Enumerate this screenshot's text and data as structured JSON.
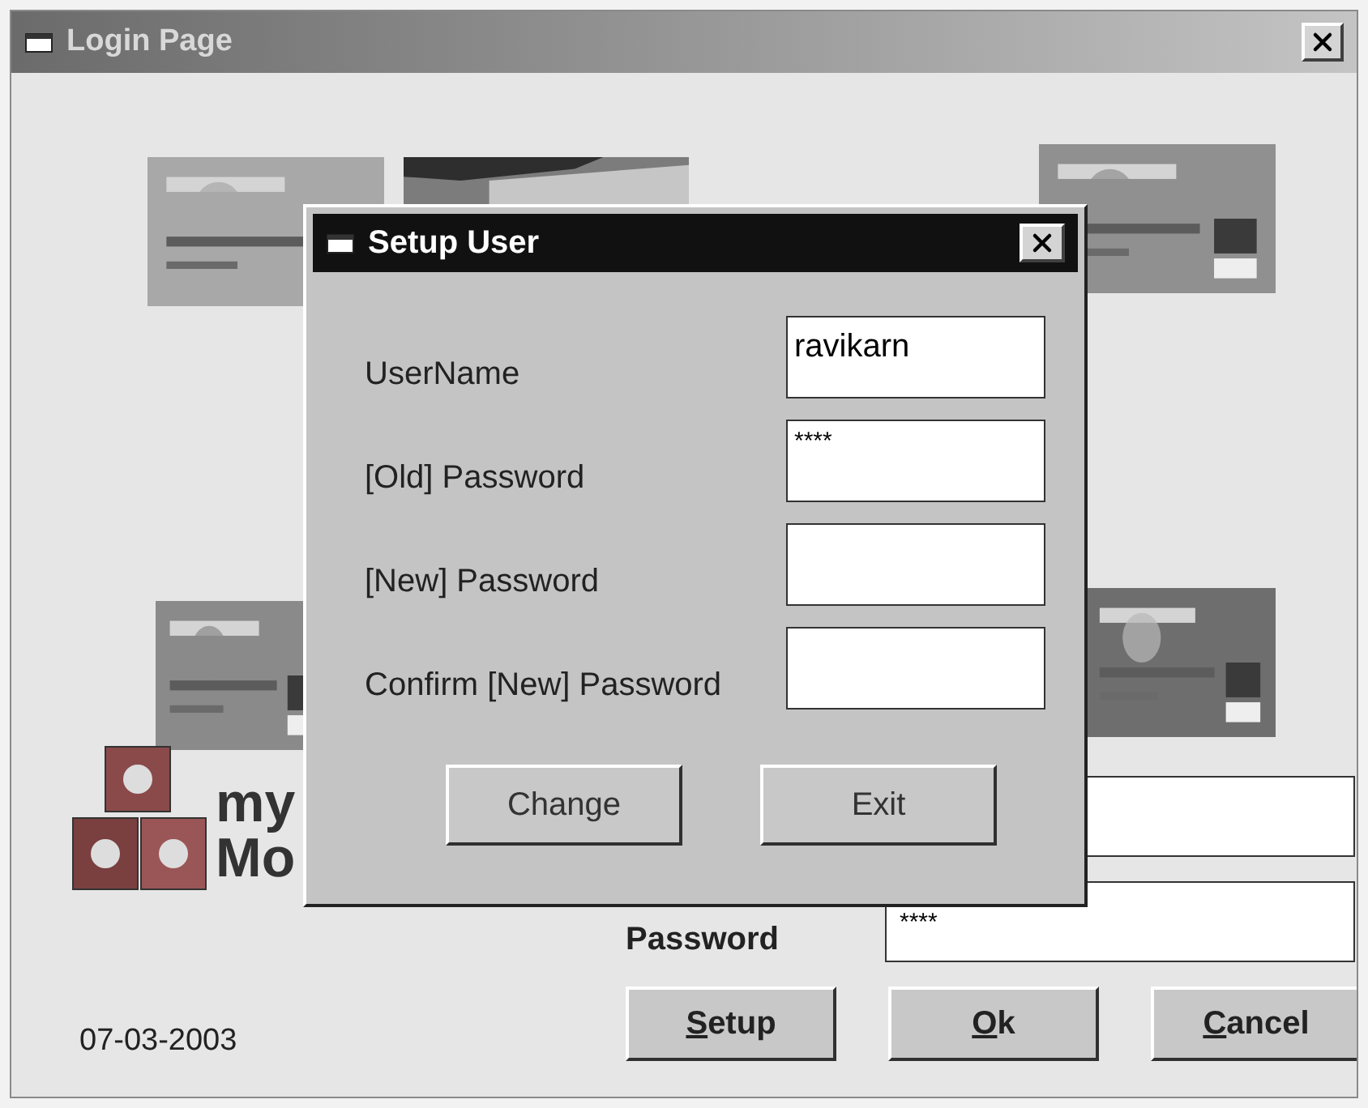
{
  "window": {
    "title": "Login Page"
  },
  "logo": {
    "line_1": "my",
    "line_2": "Mo"
  },
  "login_form": {
    "password_label": "Password",
    "password_value": "****"
  },
  "date": "07-03-2003",
  "buttons": [
    {
      "label": "Setup",
      "underline_first": true
    },
    {
      "label": "Ok",
      "underline_first": true
    },
    {
      "label": "Cancel",
      "underline_first": true
    }
  ],
  "dialog": {
    "title": "Setup User",
    "fields": [
      {
        "label": "UserName",
        "value": "ravikarn",
        "masked": false
      },
      {
        "label": "[Old] Password",
        "value": "****",
        "masked": true
      },
      {
        "label": "[New] Password"
      },
      {
        "label": "Confirm [New] Password"
      }
    ],
    "buttons": [
      {
        "label": "Change"
      },
      {
        "label": "Exit"
      }
    ]
  }
}
